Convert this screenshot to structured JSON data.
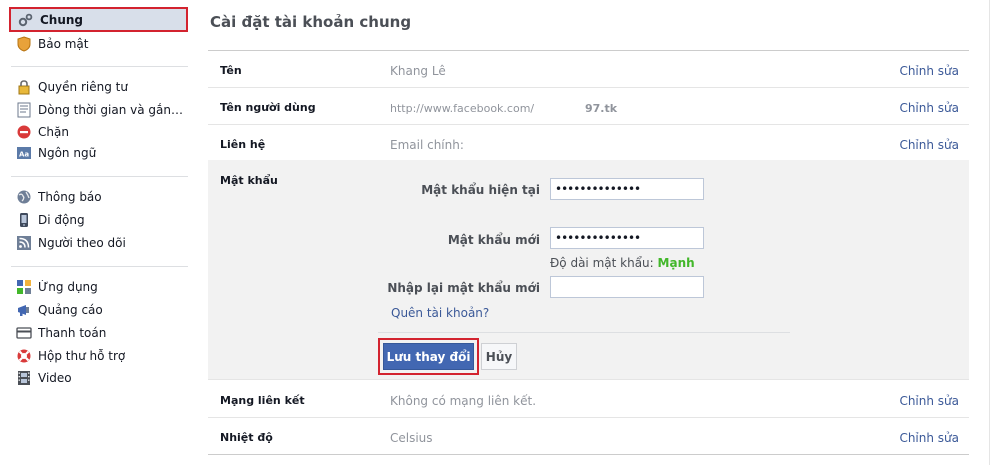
{
  "sidebar": {
    "items": [
      {
        "label": "Chung",
        "icon": "gear-icon"
      },
      {
        "label": "Bảo mật",
        "icon": "shield-icon"
      },
      {
        "label": "Quyền riêng tư",
        "icon": "lock-icon"
      },
      {
        "label": "Dòng thời gian và gắn t...",
        "icon": "timeline-icon"
      },
      {
        "label": "Chặn",
        "icon": "block-icon"
      },
      {
        "label": "Ngôn ngữ",
        "icon": "language-icon"
      },
      {
        "label": "Thông báo",
        "icon": "globe-icon"
      },
      {
        "label": "Di động",
        "icon": "mobile-icon"
      },
      {
        "label": "Người theo dõi",
        "icon": "rss-icon"
      },
      {
        "label": "Ứng dụng",
        "icon": "apps-icon"
      },
      {
        "label": "Quảng cáo",
        "icon": "ads-icon"
      },
      {
        "label": "Thanh toán",
        "icon": "card-icon"
      },
      {
        "label": "Hộp thư hỗ trợ",
        "icon": "lifebuoy-icon"
      },
      {
        "label": "Video",
        "icon": "film-icon"
      }
    ]
  },
  "main": {
    "title": "Cài đặt tài khoản chung",
    "edit_label": "Chỉnh sửa",
    "rows": {
      "name": {
        "label": "Tên",
        "value": "Khang Lê"
      },
      "username": {
        "label": "Tên người dùng",
        "value": "http://www.facebook.com/",
        "suffix": "97.tk"
      },
      "contact": {
        "label": "Liên hệ",
        "value": "Email chính:"
      },
      "network": {
        "label": "Mạng liên kết",
        "value": "Không có mạng liên kết."
      },
      "temperature": {
        "label": "Nhiệt độ",
        "value": "Celsius"
      }
    },
    "password": {
      "label": "Mật khẩu",
      "current_label": "Mật khẩu hiện tại",
      "current_value": "••••••••••••••",
      "new_label": "Mật khẩu mới",
      "new_value": "••••••••••••••",
      "strength_label": "Độ dài mật khẩu:",
      "strength_value": "Mạnh",
      "confirm_label": "Nhập lại mật khẩu mới",
      "confirm_value": "",
      "forgot_link": "Quên tài khoản?",
      "save_button": "Lưu thay đổi",
      "cancel_button": "Hủy"
    }
  },
  "colors": {
    "link": "#3b5998",
    "primary_button": "#4267b2",
    "highlight_border": "#d3232f",
    "strength": "#42b72a",
    "selected_bg": "#d8dfea"
  }
}
